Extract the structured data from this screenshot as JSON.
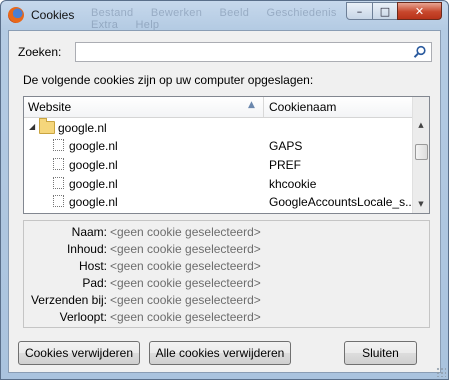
{
  "window": {
    "title": "Cookies",
    "background_menu": "Bestand Bewerken Beeld Geschiedenis Bladwijzers Extra Help",
    "controls": {
      "minimize": "–",
      "maximize": "□",
      "close": "✕"
    }
  },
  "search": {
    "label": "Zoeken:",
    "value": "",
    "icon": "search-icon"
  },
  "intro_text": "De volgende cookies zijn op uw computer opgeslagen:",
  "tree": {
    "columns": {
      "website": "Website",
      "cookie_name": "Cookienaam"
    },
    "sort_indicator": "▲",
    "rows": [
      {
        "site": "google.nl",
        "cookie": "",
        "type": "folder",
        "expander": "◢"
      },
      {
        "site": "google.nl",
        "cookie": "GAPS",
        "type": "cookie"
      },
      {
        "site": "google.nl",
        "cookie": "PREF",
        "type": "cookie"
      },
      {
        "site": "google.nl",
        "cookie": "khcookie",
        "type": "cookie"
      },
      {
        "site": "google.nl",
        "cookie": "GoogleAccountsLocale_s...",
        "type": "cookie"
      }
    ],
    "scroll_up": "▲",
    "scroll_down": "▼"
  },
  "details": [
    {
      "label": "Naam:",
      "value": "<geen cookie geselecteerd>"
    },
    {
      "label": "Inhoud:",
      "value": "<geen cookie geselecteerd>"
    },
    {
      "label": "Host:",
      "value": "<geen cookie geselecteerd>"
    },
    {
      "label": "Pad:",
      "value": "<geen cookie geselecteerd>"
    },
    {
      "label": "Verzenden bij:",
      "value": "<geen cookie geselecteerd>"
    },
    {
      "label": "Verloopt:",
      "value": "<geen cookie geselecteerd>"
    }
  ],
  "buttons": {
    "remove": "Cookies verwijderen",
    "remove_all": "Alle cookies verwijderen",
    "close": "Sluiten"
  }
}
